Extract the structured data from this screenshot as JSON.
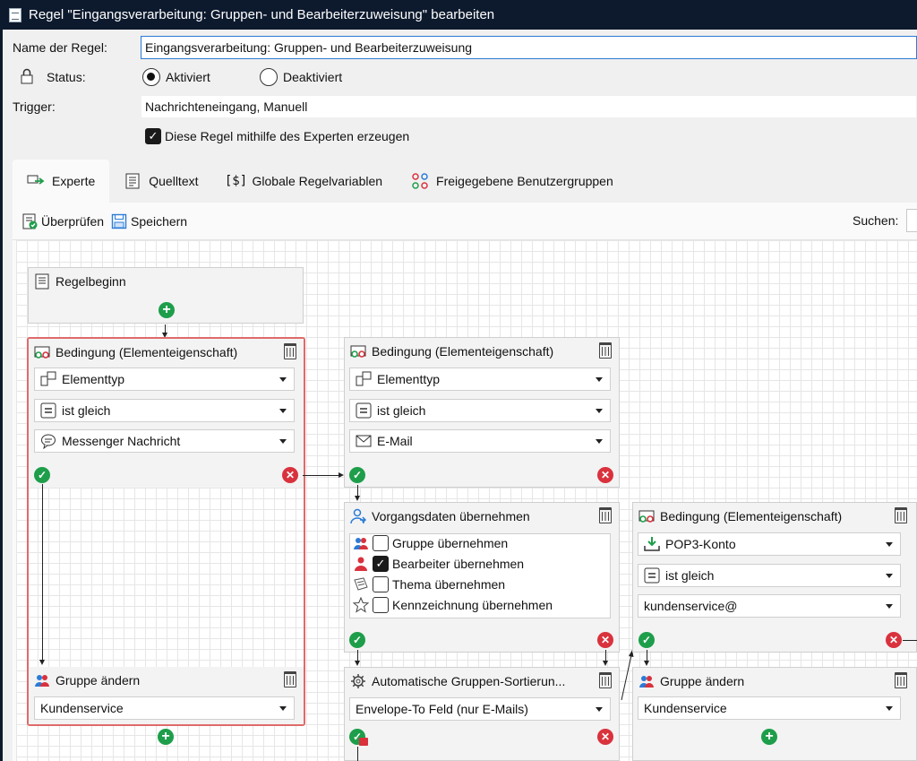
{
  "window": {
    "title": "Regel \"Eingangsverarbeitung: Gruppen- und Bearbeiterzuweisung\" bearbeiten"
  },
  "form": {
    "name_label": "Name der Regel:",
    "name_value": "Eingangsverarbeitung: Gruppen- und Bearbeiterzuweisung",
    "status_label": "Status:",
    "status_options": [
      "Aktiviert",
      "Deaktiviert"
    ],
    "status_selected": "Aktiviert",
    "trigger_label": "Trigger:",
    "trigger_value": "Nachrichteneingang, Manuell",
    "expert_checkbox_label": "Diese Regel mithilfe des Experten erzeugen",
    "expert_checked": true
  },
  "tabs": [
    {
      "label": "Experte",
      "active": true
    },
    {
      "label": "Quelltext",
      "active": false
    },
    {
      "label": "Globale Regelvariablen",
      "active": false
    },
    {
      "label": "Freigegebene Benutzergruppen",
      "active": false
    }
  ],
  "toolbar": {
    "check_label": "Überprüfen",
    "save_label": "Speichern",
    "search_label": "Suchen:"
  },
  "nodes": {
    "start": {
      "title": "Regelbeginn"
    },
    "cond1": {
      "title": "Bedingung (Elementeigenschaft)",
      "field": "Elementtyp",
      "operator": "ist gleich",
      "value": "Messenger Nachricht"
    },
    "cond2": {
      "title": "Bedingung (Elementeigenschaft)",
      "field": "Elementtyp",
      "operator": "ist gleich",
      "value": "E-Mail"
    },
    "vorgang": {
      "title": "Vorgangsdaten übernehmen",
      "items": [
        {
          "label": "Gruppe übernehmen",
          "checked": false,
          "icon": "group-icon"
        },
        {
          "label": "Bearbeiter übernehmen",
          "checked": true,
          "icon": "user-icon"
        },
        {
          "label": "Thema übernehmen",
          "checked": false,
          "icon": "topic-icon"
        },
        {
          "label": "Kennzeichnung übernehmen",
          "checked": false,
          "icon": "star-icon"
        }
      ]
    },
    "cond3": {
      "title": "Bedingung (Elementeigenschaft)",
      "field": "POP3-Konto",
      "operator": "ist gleich",
      "value": "kundenservice@"
    },
    "group1": {
      "title": "Gruppe ändern",
      "value": "Kundenservice"
    },
    "autosort": {
      "title": "Automatische Gruppen-Sortierun...",
      "value": "Envelope-To Feld (nur E-Mails)"
    },
    "group2": {
      "title": "Gruppe ändern",
      "value": "Kundenservice"
    }
  },
  "colors": {
    "accent": "#2b7bd6",
    "ok": "#1e9e4a",
    "fail": "#d9323d",
    "selection": "#e06a6a",
    "titlebar": "#0d1a2e"
  }
}
